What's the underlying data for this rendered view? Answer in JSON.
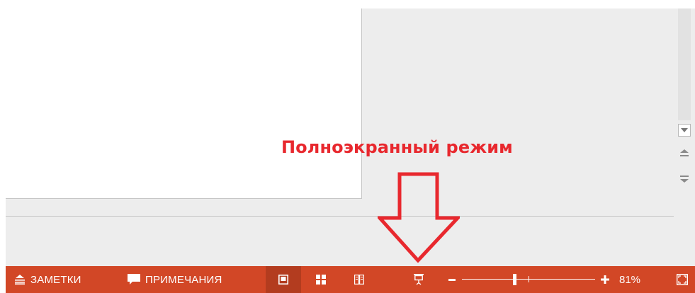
{
  "annotation": {
    "text": "Полноэкранный режим",
    "color": "#e8282e"
  },
  "colors": {
    "status_bar": "#d24726",
    "status_bar_active": "#b33c1f",
    "workspace": "#ededed",
    "slide": "#ffffff"
  },
  "scrollbar": {
    "icons": [
      "chevron-down-icon",
      "previous-slide-icon",
      "next-slide-icon"
    ]
  },
  "status_bar": {
    "notes": {
      "label": "ЗАМЕТКИ",
      "icon": "notes-icon"
    },
    "comments": {
      "label": "ПРИМЕЧАНИЯ",
      "icon": "comment-icon"
    },
    "views": [
      {
        "name": "normal",
        "icon": "normal-view-icon",
        "active": true
      },
      {
        "name": "slide-sorter",
        "icon": "slide-sorter-icon",
        "active": false
      },
      {
        "name": "reading",
        "icon": "reading-view-icon",
        "active": false
      },
      {
        "name": "slide-show",
        "icon": "slide-show-icon",
        "active": false
      }
    ],
    "zoom": {
      "minus_icon": "minus-icon",
      "plus_icon": "plus-icon",
      "level_percent": 81,
      "label": "81%"
    },
    "fit": {
      "icon": "fit-to-window-icon"
    }
  }
}
